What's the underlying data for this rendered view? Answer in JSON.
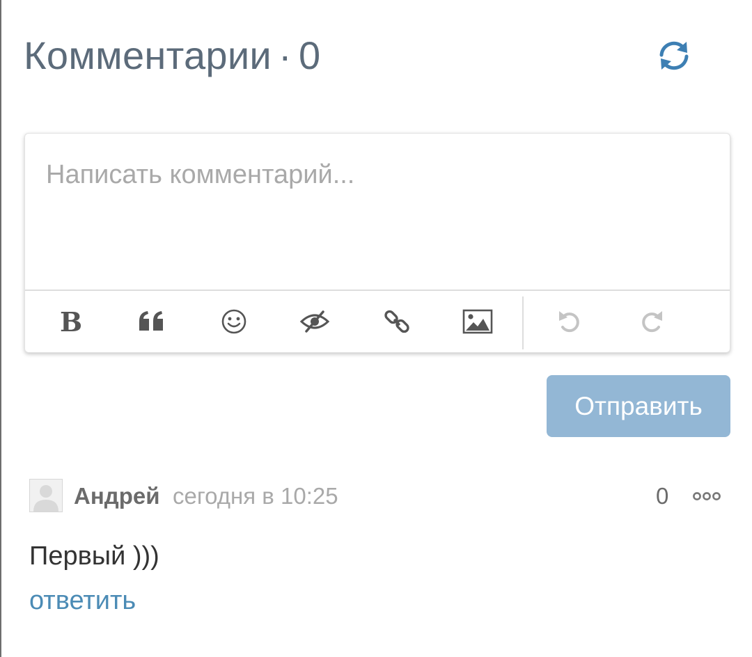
{
  "header": {
    "title": "Комментарии",
    "separator": "·",
    "count": "0",
    "refresh_icon": "refresh-icon",
    "accent_color": "#3d7fb3"
  },
  "editor": {
    "placeholder": "Написать комментарий...",
    "value": "",
    "toolbar": {
      "bold_label": "B",
      "icons": [
        "bold-icon",
        "quote-icon",
        "smile-icon",
        "spoiler-icon",
        "link-icon",
        "image-icon",
        "undo-icon",
        "redo-icon"
      ]
    }
  },
  "send_button": {
    "label": "Отправить",
    "color": "#93b7d5"
  },
  "comments": [
    {
      "author": "Андрей",
      "time": "сегодня в 10:25",
      "rating": "0",
      "text": "Первый )))",
      "reply_label": "ответить",
      "avatar_icon": "user-avatar-icon",
      "more_icon": "more-options-icon"
    }
  ]
}
